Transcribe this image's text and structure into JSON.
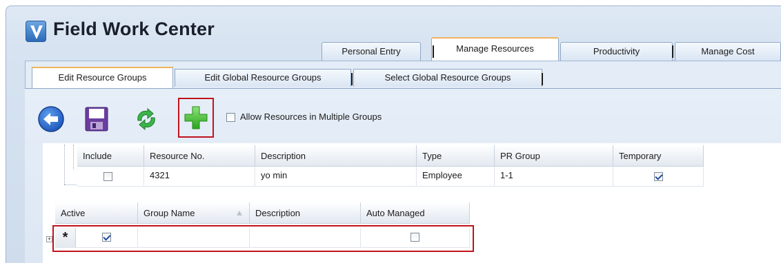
{
  "app": {
    "title": "Field Work Center"
  },
  "top_tabs": [
    {
      "label": "Personal Entry",
      "active": false
    },
    {
      "label": "Manage Resources",
      "active": true
    },
    {
      "label": "Productivity",
      "active": false
    },
    {
      "label": "Manage Cost",
      "active": false
    }
  ],
  "sub_tabs": [
    {
      "label": "Edit Resource Groups",
      "active": true
    },
    {
      "label": "Edit Global Resource Groups",
      "active": false
    },
    {
      "label": "Select Global Resource Groups",
      "active": false
    }
  ],
  "toolbar": {
    "icons": [
      "back-arrow-icon",
      "save-icon",
      "refresh-icon",
      "add-icon"
    ],
    "allow_multiple_label": "Allow Resources in Multiple Groups",
    "allow_multiple_checked": false
  },
  "resources_grid": {
    "columns": [
      "Include",
      "Resource No.",
      "Description",
      "Type",
      "PR Group",
      "Temporary"
    ],
    "rows": [
      {
        "include": false,
        "resource_no": "4321",
        "description": "yo min",
        "type": "Employee",
        "pr_group": "1-1",
        "temporary": true
      }
    ]
  },
  "groups_grid": {
    "columns": [
      "Active",
      "Group Name",
      "Description",
      "Auto Managed"
    ],
    "sorted_column": "Group Name",
    "new_row": {
      "indicator": "*",
      "active": true,
      "group_name": "",
      "description": "",
      "auto_managed": false
    }
  },
  "colors": {
    "highlight": "#c0121b",
    "active_tab_accent": "#f0b35a",
    "add_icon": "#3fbf2a"
  }
}
